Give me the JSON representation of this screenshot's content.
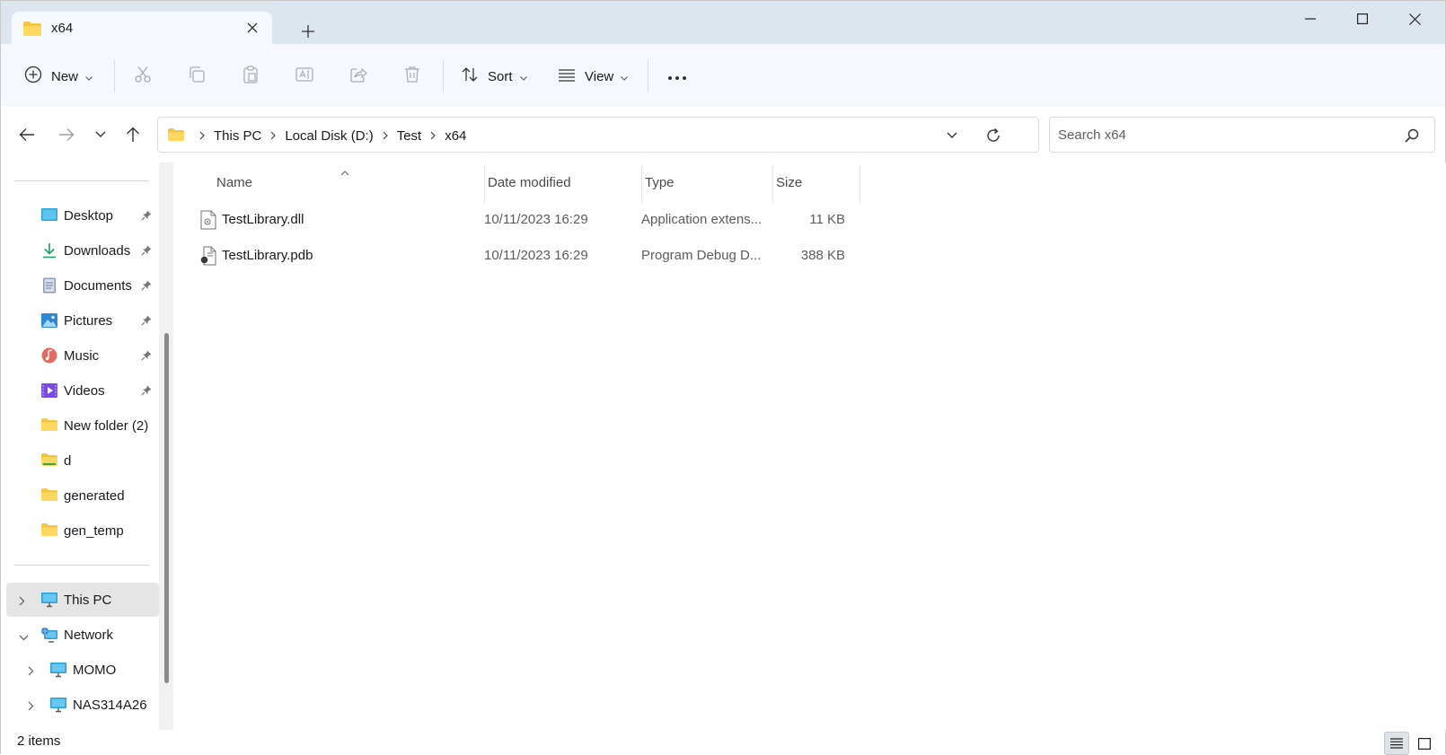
{
  "window": {
    "tab_title": "x64",
    "minimize_icon": "minimize-icon",
    "maximize_icon": "maximize-icon",
    "close_icon": "close-icon"
  },
  "toolbar": {
    "new_label": "New",
    "sort_label": "Sort",
    "view_label": "View",
    "icons": [
      "cut-icon",
      "copy-icon",
      "paste-icon",
      "rename-icon",
      "share-icon",
      "delete-icon",
      "more-icon"
    ]
  },
  "address": {
    "crumbs": [
      "This PC",
      "Local Disk (D:)",
      "Test",
      "x64"
    ]
  },
  "search": {
    "placeholder": "Search x64"
  },
  "sidebar": {
    "items": [
      {
        "label": "Desktop",
        "icon": "desktop-icon",
        "pinned": true
      },
      {
        "label": "Downloads",
        "icon": "downloads-icon",
        "pinned": true
      },
      {
        "label": "Documents",
        "icon": "documents-icon",
        "pinned": true
      },
      {
        "label": "Pictures",
        "icon": "pictures-icon",
        "pinned": true
      },
      {
        "label": "Music",
        "icon": "music-icon",
        "pinned": true
      },
      {
        "label": "Videos",
        "icon": "videos-icon",
        "pinned": true
      },
      {
        "label": "New folder (2)",
        "icon": "folder-icon",
        "pinned": false
      },
      {
        "label": "d",
        "icon": "folder-icon",
        "pinned": false
      },
      {
        "label": "generated",
        "icon": "folder-icon",
        "pinned": false
      },
      {
        "label": "gen_temp",
        "icon": "folder-icon",
        "pinned": false
      }
    ],
    "tree": [
      {
        "label": "This PC",
        "icon": "computer-icon",
        "expanded": false,
        "selected": true
      },
      {
        "label": "Network",
        "icon": "network-icon",
        "expanded": true,
        "selected": false
      },
      {
        "label": "MOMO",
        "icon": "computer-icon",
        "expanded": false,
        "selected": false
      },
      {
        "label": "NAS314A26",
        "icon": "computer-icon",
        "expanded": false,
        "selected": false
      }
    ]
  },
  "columns": {
    "name": "Name",
    "date": "Date modified",
    "type": "Type",
    "size": "Size"
  },
  "files": [
    {
      "name": "TestLibrary.dll",
      "date": "10/11/2023 16:29",
      "type": "Application extens...",
      "size": "11 KB",
      "icon": "dll-file-icon"
    },
    {
      "name": "TestLibrary.pdb",
      "date": "10/11/2023 16:29",
      "type": "Program Debug D...",
      "size": "388 KB",
      "icon": "pdb-file-icon"
    }
  ],
  "status": {
    "items_count": "2 items"
  },
  "colors": {
    "titlebar_bg": "#dde5ef",
    "toolbar_bg": "#f5f8fc",
    "folder_yellow": "#f4c542",
    "selection_bg": "#e5e5e5"
  }
}
